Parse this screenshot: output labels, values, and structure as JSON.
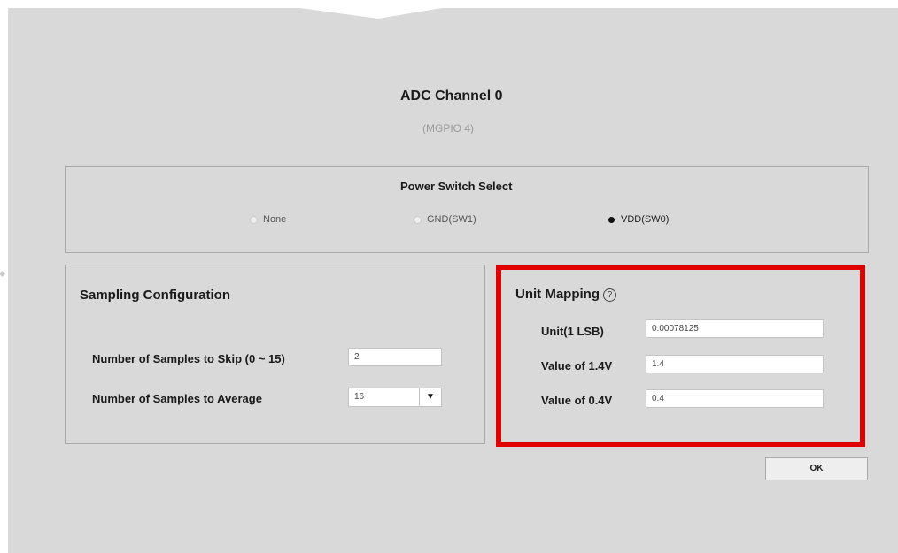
{
  "dialog": {
    "title": "ADC Channel 0",
    "subtitle": "(MGPIO 4)"
  },
  "power_switch": {
    "heading": "Power Switch Select",
    "options": [
      {
        "label": "None",
        "selected": false
      },
      {
        "label": "GND(SW1)",
        "selected": false
      },
      {
        "label": "VDD(SW0)",
        "selected": true
      }
    ]
  },
  "sampling": {
    "heading": "Sampling Configuration",
    "skip_label": "Number of Samples to Skip (0 ~ 15)",
    "skip_value": "2",
    "average_label": "Number of Samples to Average",
    "average_value": "16"
  },
  "unit_mapping": {
    "heading": "Unit Mapping",
    "help_glyph": "?",
    "unit_label": "Unit(1 LSB)",
    "unit_value": "0.00078125",
    "v14_label": "Value of 1.4V",
    "v14_value": "1.4",
    "v04_label": "Value of 0.4V",
    "v04_value": "0.4"
  },
  "buttons": {
    "ok_label": "OK"
  },
  "colors": {
    "highlight": "#e00000",
    "background": "#d9d9d9"
  }
}
